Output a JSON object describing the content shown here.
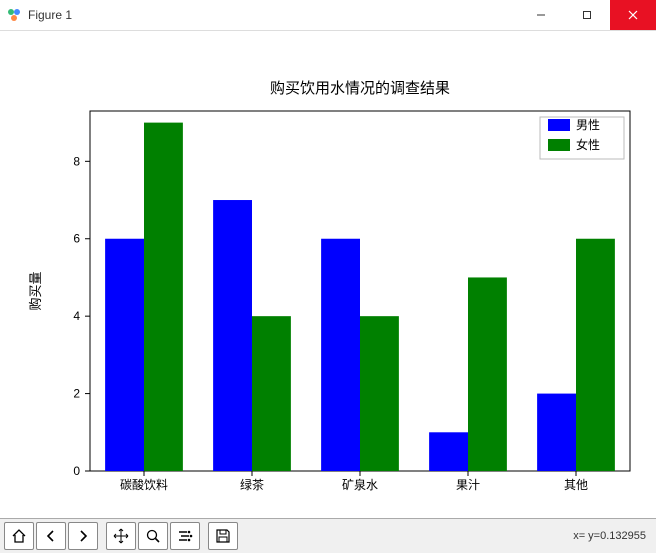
{
  "window": {
    "title": "Figure 1"
  },
  "toolbar": {
    "coord_readout": "x= y=0.132955"
  },
  "chart_data": {
    "type": "bar",
    "title": "购买饮用水情况的调查结果",
    "xlabel": "",
    "ylabel": "购买量",
    "categories": [
      "碳酸饮料",
      "绿茶",
      "矿泉水",
      "果汁",
      "其他"
    ],
    "series": [
      {
        "name": "男性",
        "color": "#0000ff",
        "values": [
          6,
          7,
          6,
          1,
          2
        ]
      },
      {
        "name": "女性",
        "color": "#008000",
        "values": [
          9,
          4,
          4,
          5,
          6
        ]
      }
    ],
    "yticks": [
      0,
      2,
      4,
      6,
      8
    ],
    "ylim": [
      0,
      9.3
    ],
    "legend_position": "upper right"
  }
}
